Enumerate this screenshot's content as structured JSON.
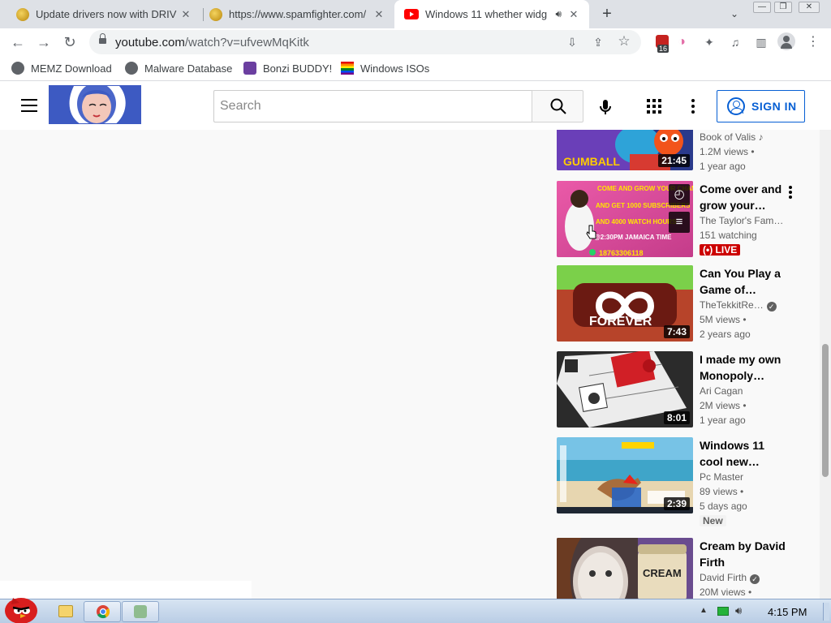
{
  "browser": {
    "tabs": [
      {
        "title": "Update drivers now with DRIV",
        "favicon": "coin-favicon-icon",
        "active": false
      },
      {
        "title": "https://www.spamfighter.com/",
        "favicon": "coin-favicon-icon",
        "active": false
      },
      {
        "title": "Windows 11 whether widg",
        "favicon": "youtube-favicon-icon",
        "active": true,
        "audio": true
      }
    ],
    "url_domain": "youtube.com",
    "url_path": "/watch?v=ufvewMqKitk",
    "extension_badge_count": "16",
    "bookmarks": [
      {
        "label": "MEMZ Download",
        "icon": "globe-icon"
      },
      {
        "label": "Malware Database",
        "icon": "globe-icon"
      },
      {
        "label": "Bonzi BUDDY!",
        "icon": "bonzi-icon"
      },
      {
        "label": "Windows ISOs",
        "icon": "rainbow-flag-icon"
      }
    ]
  },
  "youtube": {
    "search_placeholder": "Search",
    "sign_in_label": "SIGN IN",
    "accent_color": "#065fd4",
    "related": [
      {
        "title": "",
        "channel": "Book of Valis",
        "channel_suffix": "♪",
        "views": "1.2M views",
        "age": "1 year ago",
        "duration": "21:45",
        "badge": ""
      },
      {
        "title": "Come over and grow your…",
        "channel": "The Taylor's Fam…",
        "views": "151 watching",
        "age": "",
        "duration": "",
        "badge": "LIVE"
      },
      {
        "title": "Can You Play a Game of…",
        "channel": "TheTekkitRe…",
        "verified": true,
        "views": "5M views",
        "age": "2 years ago",
        "duration": "7:43",
        "badge": ""
      },
      {
        "title": "I made my own Monopoly…",
        "channel": "Ari Cagan",
        "views": "2M views",
        "age": "1 year ago",
        "duration": "8:01",
        "badge": ""
      },
      {
        "title": "Windows 11 cool new…",
        "channel": "Pc Master",
        "views": "89 views",
        "age": "5 days ago",
        "duration": "2:39",
        "badge": "New"
      },
      {
        "title": "Cream by David Firth",
        "channel": "David Firth",
        "verified": true,
        "views": "20M views",
        "age": "",
        "duration": "",
        "badge": ""
      }
    ],
    "thumb_texts": {
      "gumball": "GUMBALL",
      "grow_line1": "COME AND GROW YOUR CHANNEL",
      "grow_line2": "AND GET 1000 SUBSCRIBERS",
      "grow_line3": "AND 4000 WATCH HOURS",
      "grow_line4": "@2:30PM JAMAICA TIME",
      "grow_phone": "18763306118",
      "forever": "FOREVER",
      "cream": "CREAM"
    }
  },
  "taskbar": {
    "clock": "4:15 PM"
  }
}
